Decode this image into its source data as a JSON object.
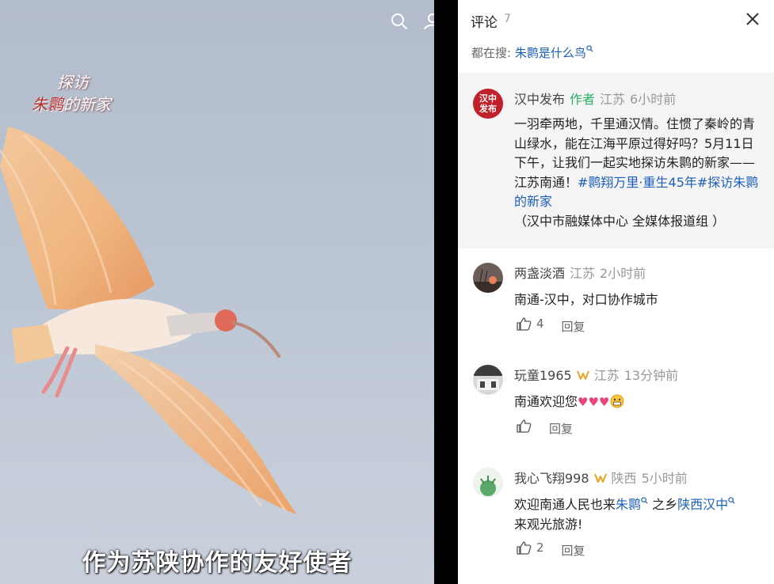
{
  "video": {
    "logo_line1": "探访",
    "logo_line2a": "朱鹮",
    "logo_line2b": "的新家",
    "subtitle": "作为苏陕协作的友好使者"
  },
  "panel": {
    "title": "评论",
    "count": "7",
    "trending_prefix": "都在搜:",
    "trending_link": "朱鹮是什么鸟"
  },
  "author_post": {
    "avatar_text": "汉中\n发布",
    "name": "汉中发布",
    "author_tag": "作者",
    "location": "江苏",
    "time": "6小时前",
    "text_a": "一羽牵两地，千里通汉情。住惯了秦岭的青山绿水，能在江海平原过得好吗？5月11日下午，让我们一起实地探访朱鹮的新家——江苏南通！",
    "tag1": "#鹮翔万里·重生45年#",
    "tag2": "探访朱鹮的新家",
    "text_b": " （汉中市融媒体中心 全媒体报道组 ）"
  },
  "comments": [
    {
      "name": "两盏淡酒",
      "location": "江苏",
      "time": "2小时前",
      "text": "南通-汉中，对口协作城市",
      "likes": "4",
      "reply": "回复"
    },
    {
      "name": "玩童1965",
      "location": "江苏",
      "time": "13分钟前",
      "text": "南通欢迎您",
      "hearts": "♥♥♥",
      "likes": "",
      "reply": "回复"
    },
    {
      "name": "我心飞翔998",
      "location": "陕西",
      "time": "5小时前",
      "text_a": "欢迎南通人民也来",
      "link1": "朱鹮",
      "text_b": " 之乡",
      "link2": "陕西汉中",
      "text_c": "来观光旅游!",
      "likes": "2",
      "reply": "回复"
    }
  ],
  "colors": {
    "link": "#1c5fb8",
    "author_tag": "#2aae67",
    "badge": "#f0a020",
    "muted": "#999999"
  }
}
